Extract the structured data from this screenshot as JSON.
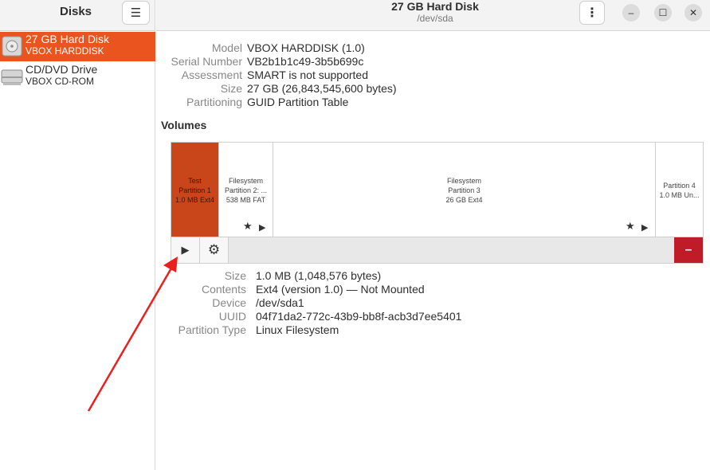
{
  "sidebar": {
    "title": "Disks",
    "menu_icon": "hamburger-menu-icon",
    "items": [
      {
        "name": "27 GB Hard Disk",
        "subtitle": "VBOX HARDDISK",
        "icon": "hard-disk-icon",
        "selected": true
      },
      {
        "name": "CD/DVD Drive",
        "subtitle": "VBOX CD-ROM",
        "icon": "optical-drive-icon",
        "selected": false
      }
    ]
  },
  "header": {
    "title": "27 GB Hard Disk",
    "subtitle": "/dev/sda",
    "menu_icon": "vertical-dots-icon",
    "minimize_glyph": "–",
    "maximize_glyph": "☐",
    "close_glyph": "✕"
  },
  "disk_properties": [
    {
      "label": "Model",
      "value": "VBOX HARDDISK (1.0)"
    },
    {
      "label": "Serial Number",
      "value": "VB2b1b1c49-3b5b699c"
    },
    {
      "label": "Assessment",
      "value": "SMART is not supported"
    },
    {
      "label": "Size",
      "value": "27 GB (26,843,545,600 bytes)"
    },
    {
      "label": "Partitioning",
      "value": "GUID Partition Table"
    }
  ],
  "volumes": {
    "title": "Volumes",
    "partitions": [
      {
        "line1": "Test",
        "line2": "Partition 1",
        "line3": "1.0 MB Ext4",
        "selected": true
      },
      {
        "line1": "Filesystem",
        "line2": "Partition 2: ...",
        "line3": "538 MB FAT",
        "selected": false
      },
      {
        "line1": "Filesystem",
        "line2": "Partition 3",
        "line3": "26 GB Ext4",
        "selected": false
      },
      {
        "line1": "Partition 4",
        "line2": "1.0 MB Un...",
        "selected": false
      }
    ],
    "mounted_star": "★",
    "mount_glyph": "▶",
    "toolbar": {
      "mount_glyph": "▶",
      "settings_glyph": "⚙",
      "delete_glyph": "–"
    }
  },
  "partition_properties": [
    {
      "label": "Size",
      "value": "1.0 MB (1,048,576 bytes)"
    },
    {
      "label": "Contents",
      "value": "Ext4 (version 1.0) — Not Mounted"
    },
    {
      "label": "Device",
      "value": "/dev/sda1"
    },
    {
      "label": "UUID",
      "value": "04f71da2-772c-43b9-bb8f-acb3d7ee5401"
    },
    {
      "label": "Partition Type",
      "value": "Linux Filesystem"
    }
  ],
  "annotation": {
    "color": "#e8201e"
  },
  "colors": {
    "accent": "#e9541f",
    "selected_partition": "#c8461a",
    "danger": "#c01c28"
  }
}
